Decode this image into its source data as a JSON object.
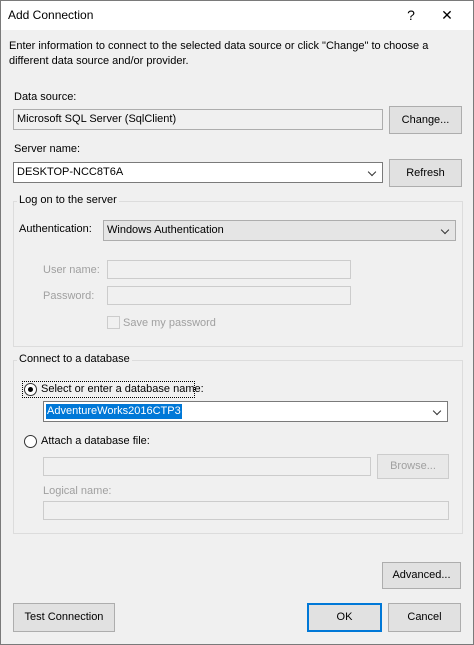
{
  "window": {
    "title": "Add Connection",
    "help_glyph": "?",
    "close_glyph": "✕"
  },
  "intro": "Enter information to connect to the selected data source or click \"Change\" to choose a different data source and/or provider.",
  "data_source": {
    "label": "Data source:",
    "value": "Microsoft SQL Server (SqlClient)",
    "change_label": "Change..."
  },
  "server": {
    "label": "Server name:",
    "value": "DESKTOP-NCC8T6A",
    "refresh_label": "Refresh"
  },
  "logon": {
    "group_title": "Log on to the server",
    "auth_label": "Authentication:",
    "auth_value": "Windows Authentication",
    "username_label": "User name:",
    "username_value": "",
    "password_label": "Password:",
    "password_value": "",
    "save_password_label": "Save my password"
  },
  "database": {
    "group_title": "Connect to a database",
    "select_label": "Select or enter a database name:",
    "select_value": "AdventureWorks2016CTP3",
    "attach_label": "Attach a database file:",
    "attach_value": "",
    "browse_label": "Browse...",
    "logical_label": "Logical name:",
    "logical_value": ""
  },
  "buttons": {
    "advanced": "Advanced...",
    "test": "Test Connection",
    "ok": "OK",
    "cancel": "Cancel"
  },
  "colors": {
    "accent": "#0078d7"
  }
}
